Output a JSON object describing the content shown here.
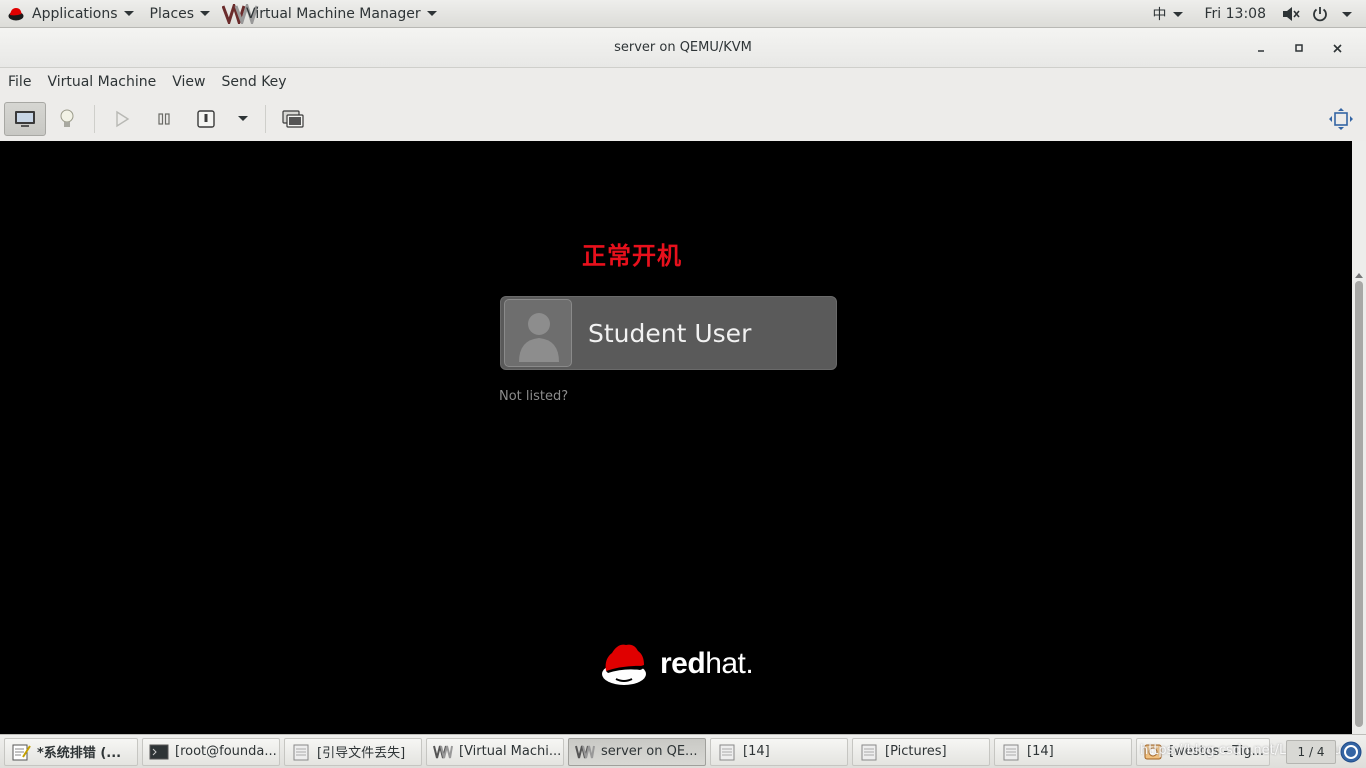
{
  "top_panel": {
    "applications": "Applications",
    "places": "Places",
    "vmm_title": "Virtual Machine Manager",
    "input_method": "中",
    "clock": "Fri 13:08"
  },
  "window": {
    "title": "server on QEMU/KVM",
    "menu": [
      "File",
      "Virtual Machine",
      "View",
      "Send Key"
    ]
  },
  "vm_screen": {
    "annotation": "正常开机",
    "user_name": "Student User",
    "not_listed": "Not listed?",
    "logo_bold": "red",
    "logo_light": "hat."
  },
  "taskbar": {
    "tasks": [
      {
        "label": "*系统排错 (...",
        "icon": "text-editor-icon"
      },
      {
        "label": "[root@founda...",
        "icon": "terminal-icon"
      },
      {
        "label": "[引导文件丢失]",
        "icon": "window-icon"
      },
      {
        "label": "[Virtual Machi...",
        "icon": "vmm-icon"
      },
      {
        "label": "server on QE...",
        "icon": "vmm-icon"
      },
      {
        "label": "[14]",
        "icon": "window-icon"
      },
      {
        "label": "[Pictures]",
        "icon": "window-icon"
      },
      {
        "label": "[14]",
        "icon": "window-icon"
      },
      {
        "label": "[westos - Tig...",
        "icon": "image-viewer-icon"
      }
    ],
    "pager": "1 / 4",
    "watermark": "https://blog.csdn.net/Lssiec_gu"
  },
  "colors": {
    "annotation": "#e8101c",
    "redhat_red": "#e00000"
  }
}
